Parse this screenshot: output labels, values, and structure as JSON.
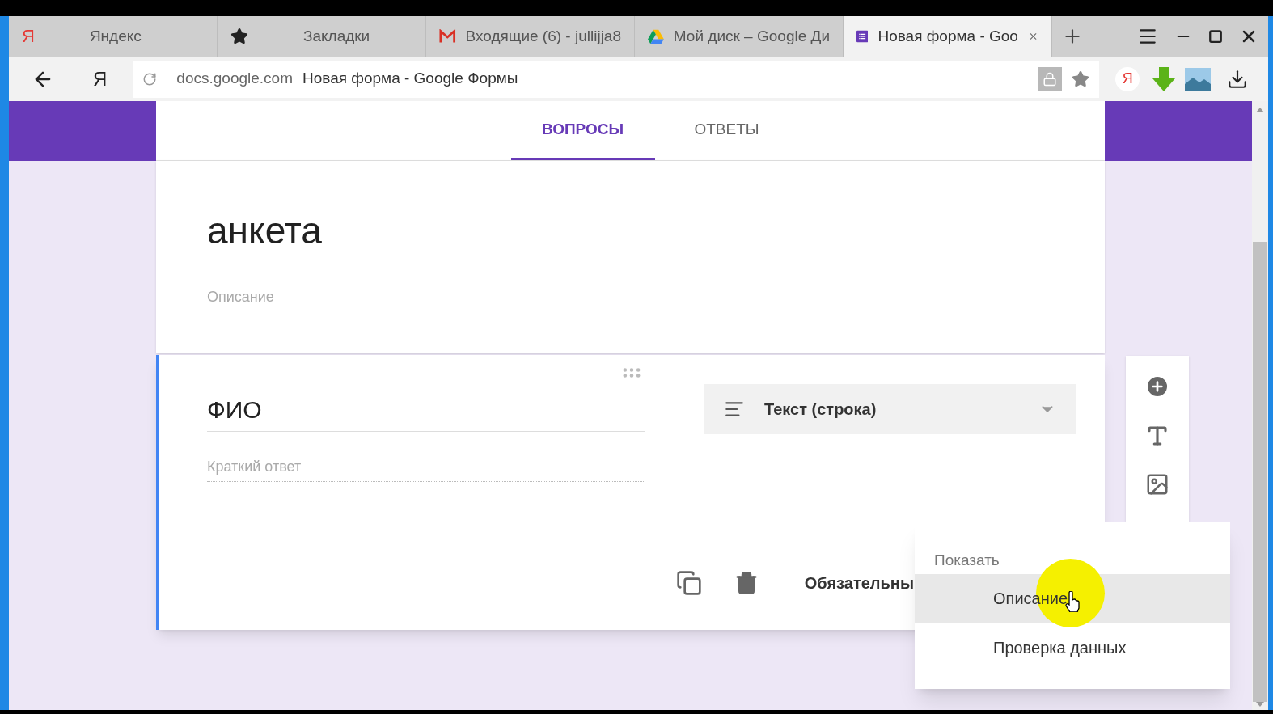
{
  "browser": {
    "tabs": [
      {
        "kind": "yandex",
        "logo": "Я",
        "title": "Яндекс",
        "selected": false
      },
      {
        "kind": "star",
        "title": "Закладки",
        "selected": false
      },
      {
        "kind": "gmail",
        "title": "Входящие (6) - jullijja8",
        "selected": false
      },
      {
        "kind": "drive",
        "title": "Мой диск – Google Ди",
        "selected": false
      },
      {
        "kind": "forms",
        "title": "Новая форма - Goo",
        "selected": true
      }
    ],
    "home_logo": "Я",
    "url_domain": "docs.google.com",
    "url_title": "Новая форма - Google Формы",
    "extension_logo": "Я"
  },
  "form_tabs": [
    {
      "label": "ВОПРОСЫ",
      "selected": true
    },
    {
      "label": "ОТВЕТЫ",
      "selected": false
    }
  ],
  "form": {
    "title": "анкета",
    "description_placeholder": "Описание"
  },
  "question": {
    "title": "ФИО",
    "type": "Текст (строка)",
    "answer_hint": "Краткий ответ",
    "required_label": "Обязательны"
  },
  "menu": {
    "header": "Показать",
    "items": [
      {
        "label": "Описание",
        "highlighted": true
      },
      {
        "label": "Проверка данных",
        "highlighted": false
      }
    ]
  }
}
